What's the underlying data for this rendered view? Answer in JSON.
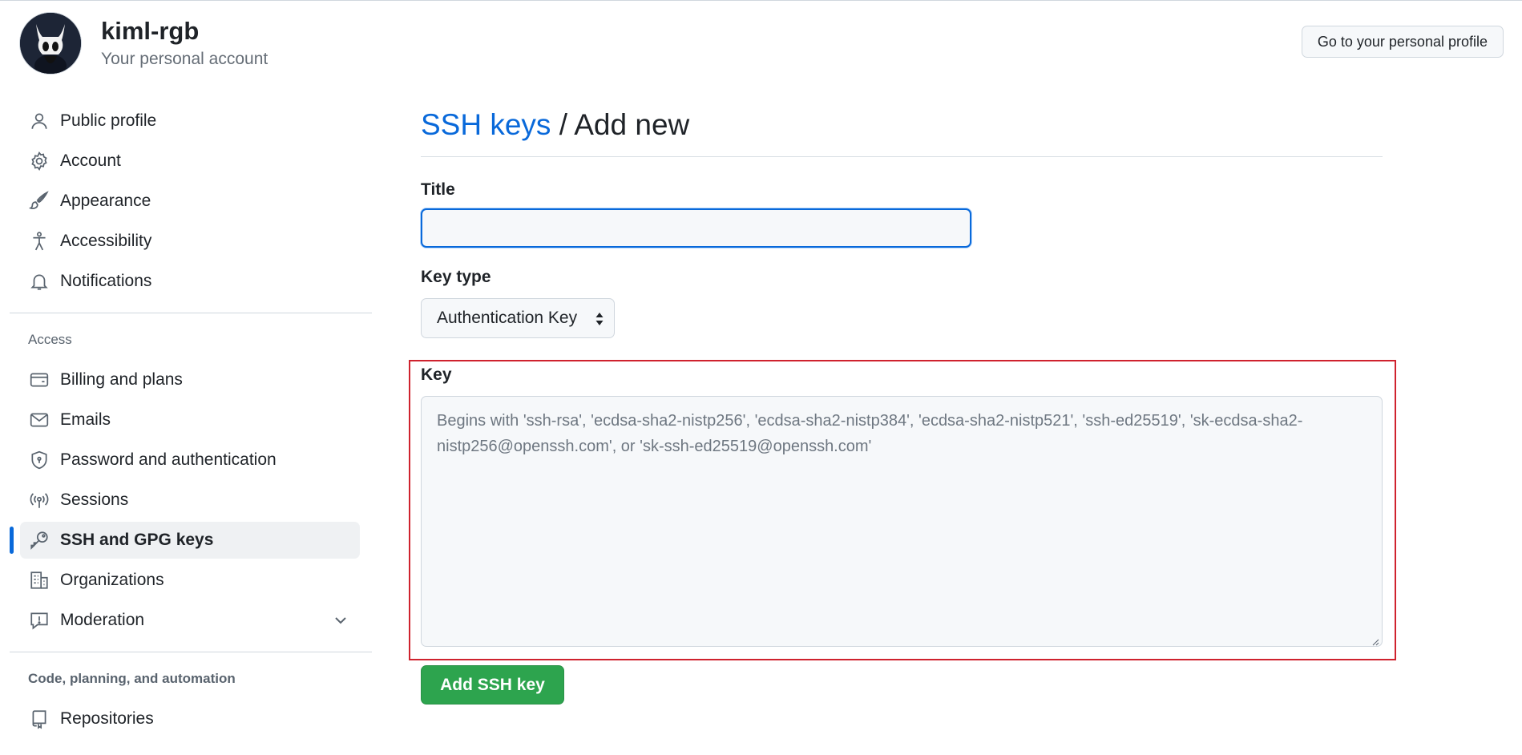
{
  "header": {
    "username": "kiml-rgb",
    "subtitle": "Your personal account",
    "profile_button": "Go to your personal profile"
  },
  "sidebar": {
    "items": [
      {
        "label": "Public profile",
        "icon": "person-icon"
      },
      {
        "label": "Account",
        "icon": "gear-icon"
      },
      {
        "label": "Appearance",
        "icon": "paintbrush-icon"
      },
      {
        "label": "Accessibility",
        "icon": "accessibility-icon"
      },
      {
        "label": "Notifications",
        "icon": "bell-icon"
      }
    ],
    "access_title": "Access",
    "access_items": [
      {
        "label": "Billing and plans",
        "icon": "credit-card-icon"
      },
      {
        "label": "Emails",
        "icon": "mail-icon"
      },
      {
        "label": "Password and authentication",
        "icon": "shield-icon"
      },
      {
        "label": "Sessions",
        "icon": "broadcast-icon"
      },
      {
        "label": "SSH and GPG keys",
        "icon": "key-icon",
        "active": true
      },
      {
        "label": "Organizations",
        "icon": "organization-icon"
      },
      {
        "label": "Moderation",
        "icon": "report-icon",
        "expandable": true
      }
    ],
    "code_title": "Code, planning, and automation",
    "code_items": [
      {
        "label": "Repositories",
        "icon": "repo-icon"
      }
    ]
  },
  "main": {
    "breadcrumb_link": "SSH keys",
    "breadcrumb_sep": " / ",
    "page_title": "Add new",
    "title_label": "Title",
    "title_value": "",
    "key_type_label": "Key type",
    "key_type_value": "Authentication Key",
    "key_label": "Key",
    "key_placeholder": "Begins with 'ssh-rsa', 'ecdsa-sha2-nistp256', 'ecdsa-sha2-nistp384', 'ecdsa-sha2-nistp521', 'ssh-ed25519', 'sk-ecdsa-sha2-nistp256@openssh.com', or 'sk-ssh-ed25519@openssh.com'",
    "submit_button": "Add SSH key"
  },
  "colors": {
    "accent": "#0969da",
    "success": "#2da44e",
    "highlight_border": "#cf222e"
  }
}
